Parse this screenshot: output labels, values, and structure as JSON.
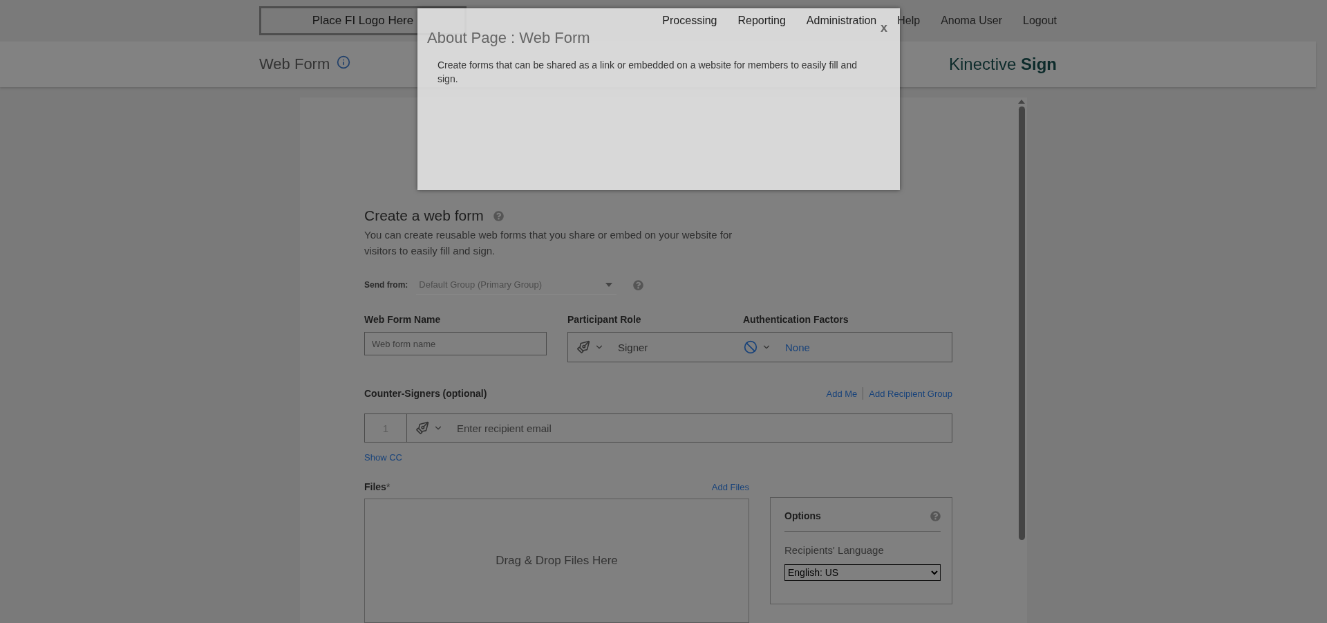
{
  "header": {
    "logo": "Place FI Logo Here",
    "nav": [
      {
        "label": "Processing"
      },
      {
        "label": "Reporting"
      },
      {
        "label": "Administration"
      },
      {
        "label": "Help"
      },
      {
        "label": "Anoma User"
      },
      {
        "label": "Logout"
      }
    ]
  },
  "subheader": {
    "title": "Web Form",
    "brand": "Kinective **Sign**"
  },
  "form": {
    "title": "Create a web form",
    "description": "You can create reusable web forms that you share or embed on your website for visitors to easily fill and sign.",
    "send_from": {
      "label": "Send from:",
      "value": "Default Group (Primary Group)"
    },
    "name_field": {
      "label": "Web Form Name",
      "placeholder": "Web form name"
    },
    "participant_role": {
      "label": "Participant Role",
      "value": "Signer"
    },
    "authentication": {
      "label": "Authentication Factors",
      "value": "None"
    },
    "counter_signers": {
      "label": "Counter-Signers (optional)",
      "links": [
        "Add Me",
        "Add Recipient Group"
      ],
      "rows": [
        {
          "number": "1",
          "placeholder": "Enter recipient email"
        }
      ]
    },
    "show_cc": "Show CC",
    "files": {
      "label": "Files",
      "required_mark": "*",
      "add_link": "Add Files",
      "dropzone": "Drag & Drop Files Here"
    },
    "options": {
      "title": "Options",
      "language_label": "Recipients' Language",
      "language": "English: US"
    }
  },
  "modal": {
    "title": "About Page : Web Form",
    "close": "x",
    "body": "Create forms that can be shared as a link or embedded on a website for members to easily fill and sign."
  }
}
